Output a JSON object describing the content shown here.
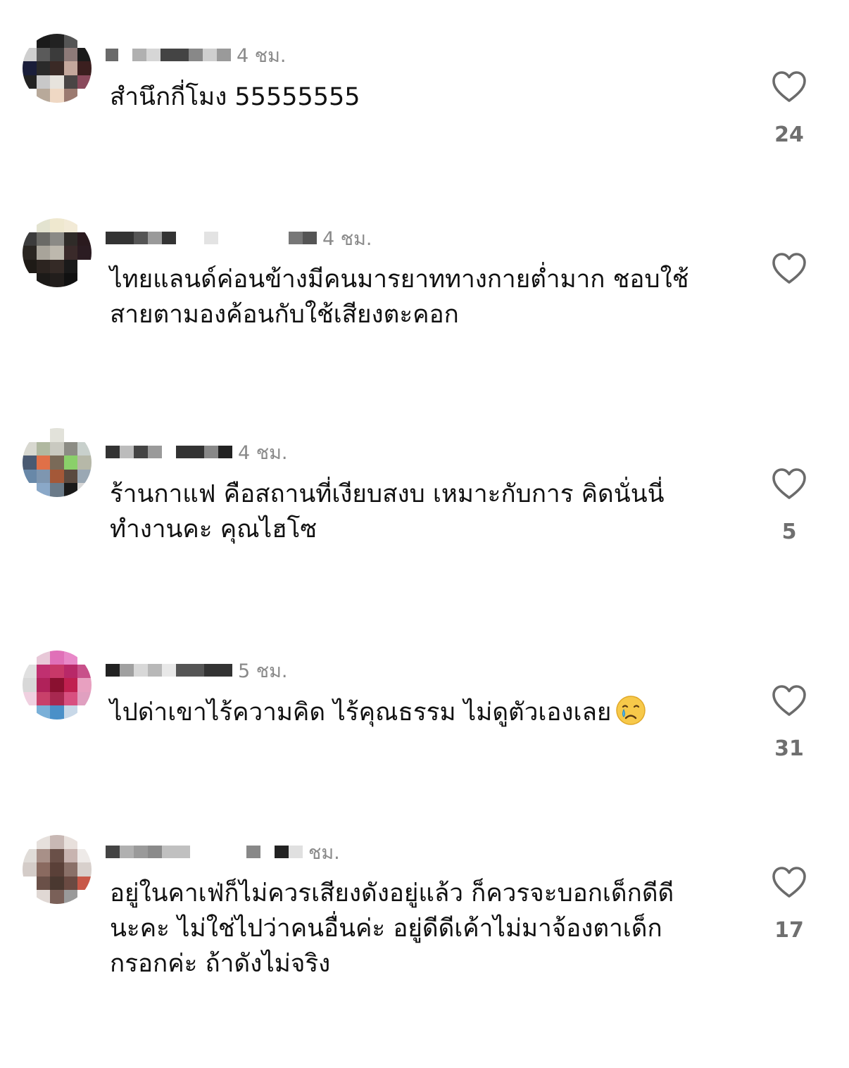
{
  "comments": [
    {
      "time": "4 ชม.",
      "text": "สำนึกกี่โมง 55555555",
      "likes": "24"
    },
    {
      "time": "4 ชม.",
      "text": "ไทยแลนด์ค่อนข้างมีคนมารยาททางกายต่ำมาก ชอบใช้\nสายตามองค้อนกับใช้เสียงตะคอก",
      "likes": ""
    },
    {
      "time": "4 ชม.",
      "text": "ร้านกาแฟ  คือสถานที่เงียบสงบ  เหมาะกับการ คิดนั่นนี่\nทำงานคะ คุณไฮโซ",
      "likes": "5"
    },
    {
      "time": "5 ชม.",
      "text": "ไปด่าเขาไร้ความคิด ไร้คุณธรรม ไม่ดูตัวเองเลย",
      "emoji": "crying-face-emoji",
      "likes": "31"
    },
    {
      "time": "ชม.",
      "text": "อยู่ในคาเฟ่ก็ไม่ควรเสียงดังอยู่แล้ว ก็ควรจะบอกเด็กดีดี\nนะคะ ไม่ใช่ไปว่าคนอื่นค่ะ อยู่ดีดีเค้าไม่มาจ้องตาเด็ก\nกรอกค่ะ ถ้าดังไม่จริง",
      "likes": "17"
    }
  ],
  "icons": {
    "like": "heart-outline-icon",
    "avatar": "pixelated-avatar",
    "username": "pixelated-username"
  },
  "colors": {
    "text": "#111111",
    "meta": "#8a8a8a",
    "like_count": "#6f6f6f",
    "heart_stroke": "#6b6b6b"
  }
}
